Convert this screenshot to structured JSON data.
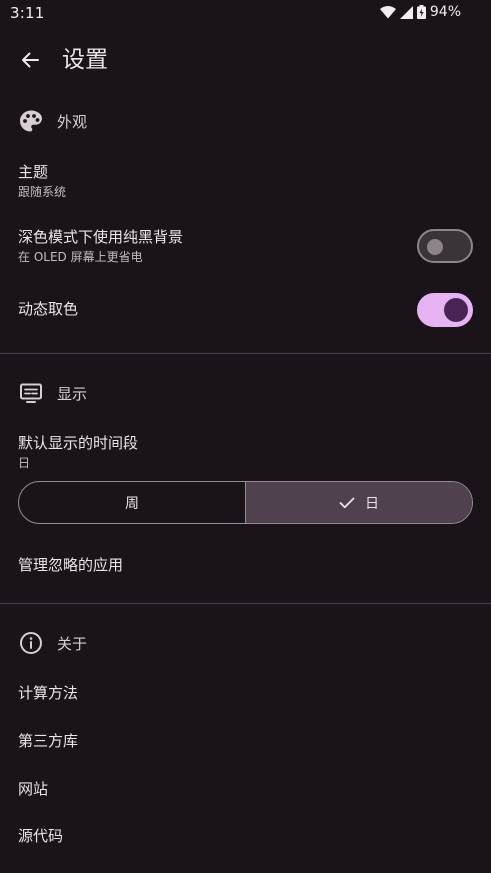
{
  "status_bar": {
    "time": "3:11",
    "battery": "94%"
  },
  "app_bar": {
    "title": "设置"
  },
  "sections": {
    "appearance": {
      "label": "外观",
      "theme": {
        "title": "主题",
        "value": "跟随系统"
      },
      "pure_black": {
        "title": "深色模式下使用纯黑背景",
        "subtitle": "在 OLED 屏幕上更省电",
        "enabled": false
      },
      "dynamic_color": {
        "title": "动态取色",
        "enabled": true
      }
    },
    "display": {
      "label": "显示",
      "default_period": {
        "title": "默认显示的时间段",
        "value": "日"
      },
      "segments": {
        "week": "周",
        "day": "日",
        "selected": "day"
      },
      "ignored_apps": {
        "title": "管理忽略的应用"
      }
    },
    "about": {
      "label": "关于",
      "items": [
        "计算方法",
        "第三方库",
        "网站",
        "源代码"
      ]
    }
  },
  "colors": {
    "background": "#1a141a",
    "accent": "#e6b4f3",
    "accent_knob": "#4a2455",
    "selected_segment": "#4f424e"
  }
}
